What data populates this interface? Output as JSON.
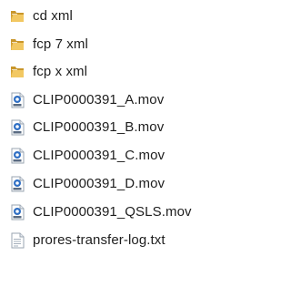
{
  "files": [
    {
      "name": "cd xml",
      "icon": "folder-icon",
      "type": "folder"
    },
    {
      "name": "fcp 7 xml",
      "icon": "folder-icon",
      "type": "folder"
    },
    {
      "name": "fcp x xml",
      "icon": "folder-icon",
      "type": "folder"
    },
    {
      "name": "CLIP0000391_A.mov",
      "icon": "quicktime-movie-icon",
      "type": "movie"
    },
    {
      "name": "CLIP0000391_B.mov",
      "icon": "quicktime-movie-icon",
      "type": "movie"
    },
    {
      "name": "CLIP0000391_C.mov",
      "icon": "quicktime-movie-icon",
      "type": "movie"
    },
    {
      "name": "CLIP0000391_D.mov",
      "icon": "quicktime-movie-icon",
      "type": "movie"
    },
    {
      "name": "CLIP0000391_QSLS.mov",
      "icon": "quicktime-movie-icon",
      "type": "movie"
    },
    {
      "name": "prores-transfer-log.txt",
      "icon": "text-document-icon",
      "type": "text"
    }
  ],
  "colors": {
    "folder": "#e8b84a",
    "folder_dark": "#c9962a",
    "movie_blue": "#2f6fc4",
    "text": "#1e1e1e"
  }
}
